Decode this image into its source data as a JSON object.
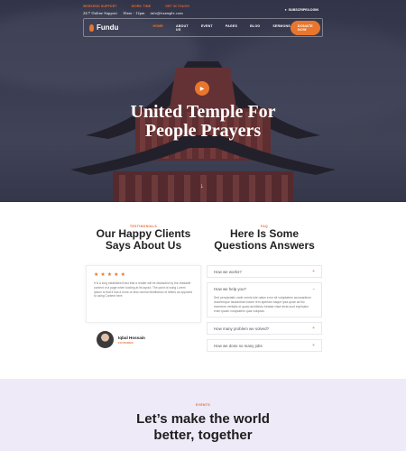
{
  "topbar": {
    "labels": [
      "WEEKEND SUPPORT",
      "WORK TIME",
      "GET IN TOUCH"
    ],
    "values": [
      "24/7 Online Support",
      "10am - 12pm",
      "info@example.com"
    ],
    "subscribe": "SUBSCRIPE/LOGIN"
  },
  "nav": {
    "logo": "Fundu",
    "items": [
      "HOME",
      "ABOUT US",
      "EVENT",
      "PAGES",
      "BLOG",
      "SERMONS"
    ],
    "donate": "DONATE NOW"
  },
  "hero": {
    "title_line1": "United Temple For",
    "title_line2": "People Prayers"
  },
  "testimonials": {
    "kicker": "TESTIMONIALS",
    "title_line1": "Our Happy Clients",
    "title_line2": "Says About Us",
    "rating": 5,
    "text": "It is a long established fact that a reader will be distracted by the readable content of a page when looking at its layout. The point of using Lorem Ipsum is that it has a more-or-less normal distribution of letters as opposed to using Content here",
    "author": "Iqbal Hossain",
    "role": "FOUNDER"
  },
  "faq": {
    "kicker": "FAQ",
    "title_line1": "Here Is Some",
    "title_line2": "Questions Answers",
    "q1": "How we works?",
    "q2": "How we help you?",
    "a2": "Sed perspiciatis unde omnis iste natus error sit voluptatem accusantium doloremque laudantium totam rem aperiam eaque ipsa quae ab illo inventore veritatis et quasi architecto beatae vitae dicta sunt explicabo enim ipsam voluptatem quia voluptas",
    "q3": "How many problem we solved?",
    "q4": "How we done so many jobs"
  },
  "events": {
    "kicker": "EVENTS",
    "title_line1": "Let’s make the world",
    "title_line2": "better, together"
  },
  "colors": {
    "accent": "#e8762e",
    "hero_bg": "#3b3e53",
    "lavender": "#eeeaf8"
  },
  "icons": {
    "play": "play-icon",
    "plus": "plus-icon",
    "star": "star-icon",
    "user": "user-icon",
    "arrow": "arrow-down-icon"
  }
}
